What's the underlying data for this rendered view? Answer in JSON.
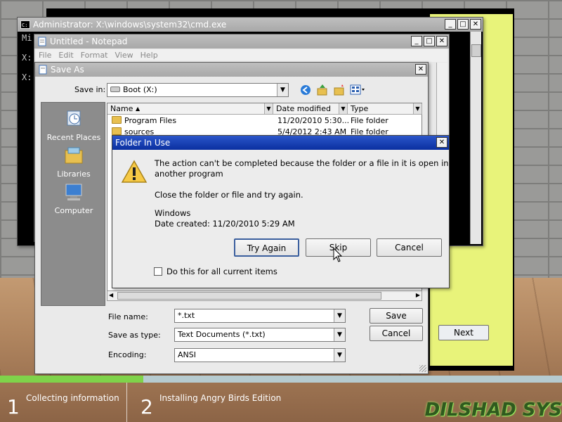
{
  "background": {
    "setup_next_label": "Next",
    "steps": [
      {
        "number": "1",
        "label": "Collecting information"
      },
      {
        "number": "2",
        "label": "Installing Angry Birds Edition"
      }
    ],
    "progress_fraction": 0.255,
    "logo_text": "DILSHAD SYS"
  },
  "cmd": {
    "title": "Administrator: X:\\windows\\system32\\cmd.exe",
    "lines": [
      "Mi",
      "",
      "X:",
      "",
      "X:"
    ]
  },
  "notepad": {
    "title": "Untitled - Notepad",
    "menu": [
      "File",
      "Edit",
      "Format",
      "View",
      "Help"
    ]
  },
  "save_as": {
    "title": "Save As",
    "save_in_label": "Save in:",
    "save_in_value": "Boot (X:)",
    "places": [
      "Recent Places",
      "Libraries",
      "Computer"
    ],
    "columns": {
      "name": "Name",
      "date": "Date modified",
      "type": "Type"
    },
    "files": [
      {
        "name": "Program Files",
        "date": "11/20/2010 5:30...",
        "type": "File folder"
      },
      {
        "name": "sources",
        "date": "5/4/2012 2:43 AM",
        "type": "File folder"
      }
    ],
    "file_name_label": "File name:",
    "file_name_value": "*.txt",
    "save_as_type_label": "Save as type:",
    "save_as_type_value": "Text Documents (*.txt)",
    "encoding_label": "Encoding:",
    "encoding_value": "ANSI",
    "save_button": "Save",
    "cancel_button": "Cancel"
  },
  "dialog": {
    "title": "Folder In Use",
    "message_line1": "The action can't be completed because the folder or a file in it is open in",
    "message_line2": "another program",
    "instruction": "Close the folder or file and try again.",
    "item_name": "Windows",
    "item_date": "Date created: 11/20/2010 5:29 AM",
    "try_again_button": "Try Again",
    "skip_button": "Skip",
    "cancel_button": "Cancel",
    "checkbox_label": "Do this for all current items"
  },
  "colors": {
    "active_title": "#0a2fa0",
    "setup_yellow": "#e8f37a",
    "progress_green": "#7fd34a"
  }
}
